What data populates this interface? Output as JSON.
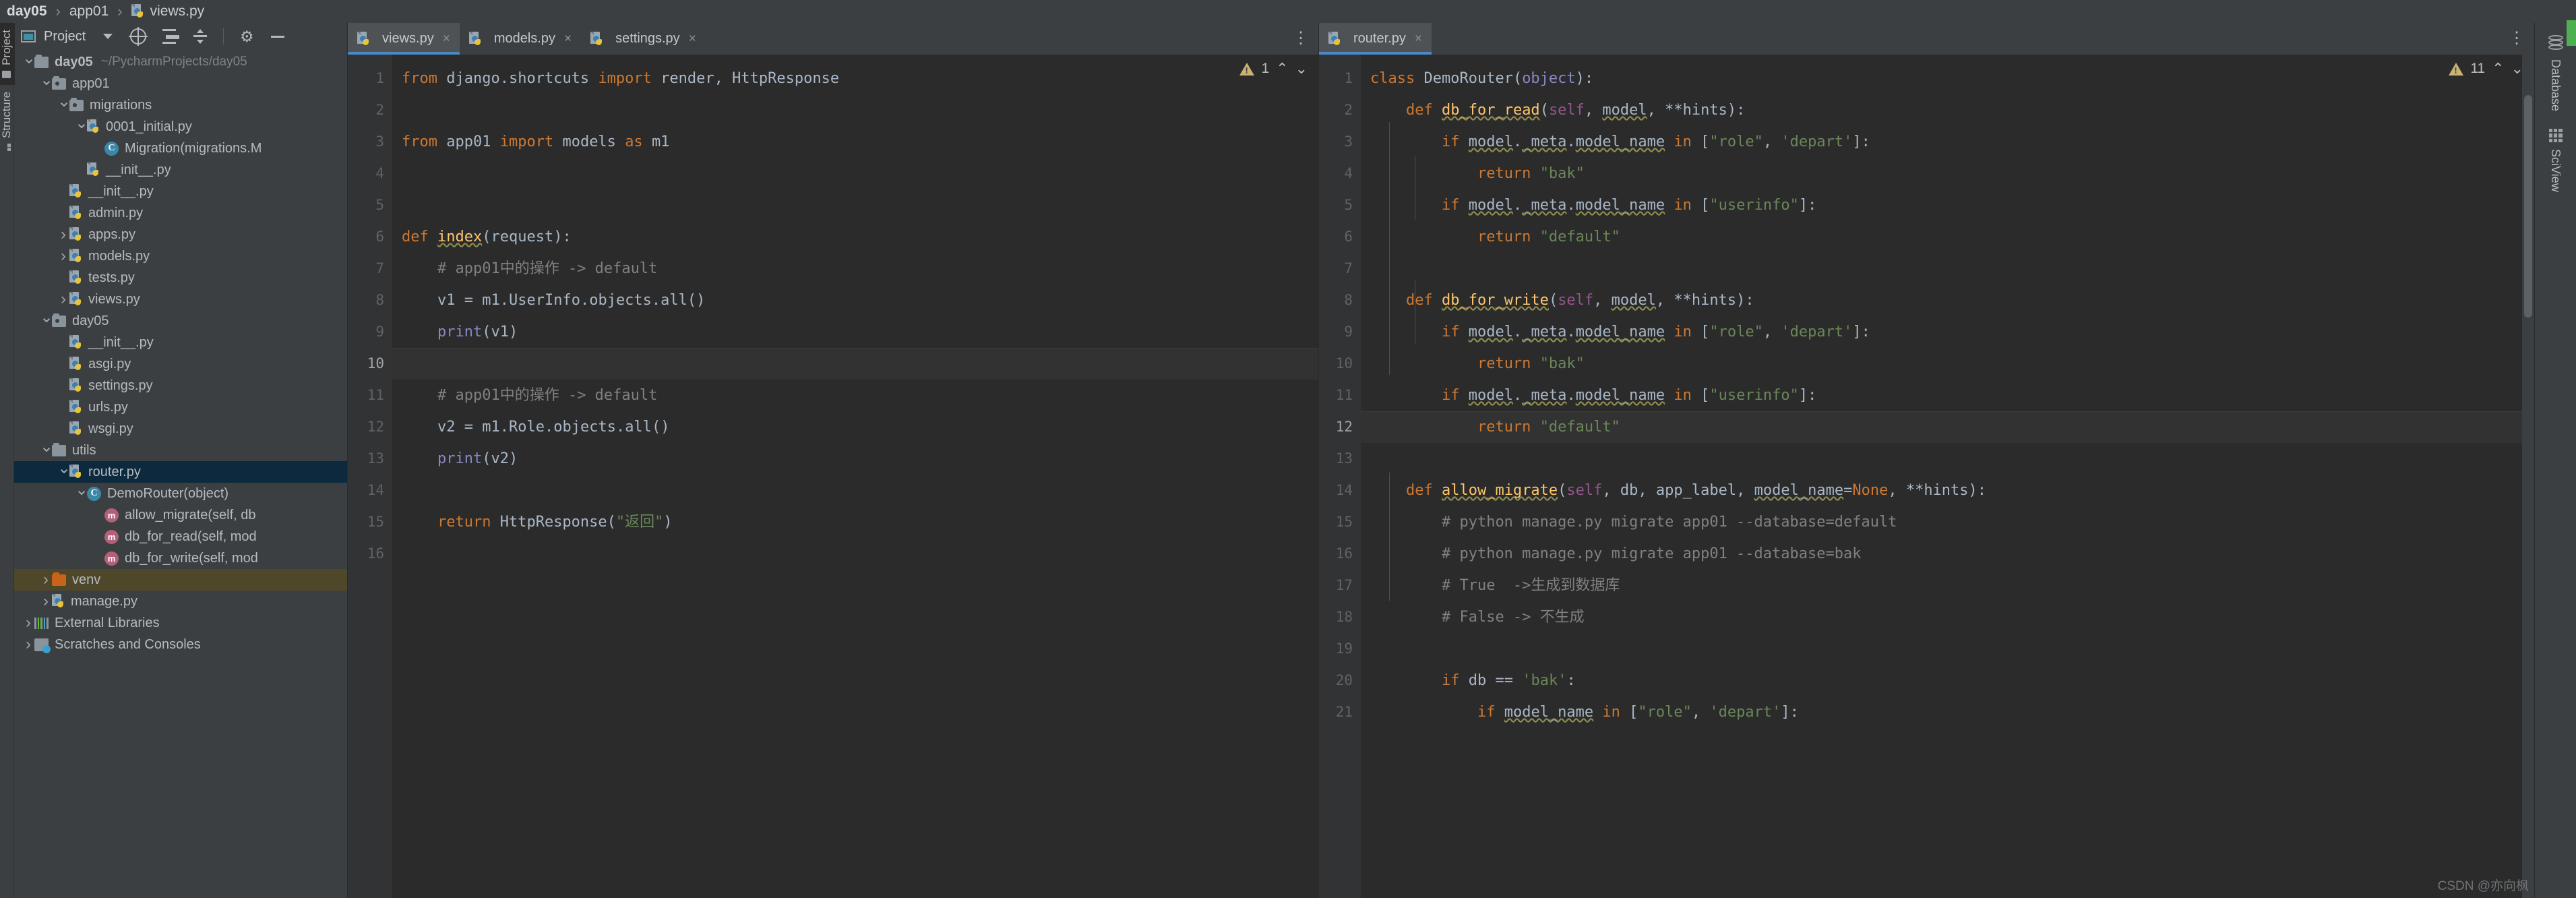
{
  "breadcrumb": {
    "items": [
      "day05",
      "app01",
      "views.py"
    ],
    "separator": "›",
    "file_icon": "python-file-icon"
  },
  "left_tool_strip": {
    "tabs": [
      {
        "label": "Project",
        "icon": "project-window-icon",
        "active": true
      },
      {
        "label": "Structure",
        "icon": "structure-icon",
        "active": false
      }
    ]
  },
  "project_panel": {
    "header": {
      "title": "Project",
      "dropdown_icon": "chevron-down-icon",
      "buttons": [
        {
          "name": "select-opened-file-icon",
          "label": "⊕"
        },
        {
          "name": "collapse-all-icon",
          "label": ""
        },
        {
          "name": "expand-all-icon",
          "label": ""
        },
        {
          "name": "settings-gear-icon",
          "label": "⚙"
        },
        {
          "name": "hide-panel-icon",
          "label": "—"
        }
      ]
    },
    "tree": [
      {
        "indent": 0,
        "arrow": "down",
        "icon": "folder",
        "label": "day05",
        "path": "~/PycharmProjects/day05",
        "bold": true
      },
      {
        "indent": 1,
        "arrow": "down",
        "icon": "folder-source",
        "label": "app01"
      },
      {
        "indent": 2,
        "arrow": "down",
        "icon": "folder-source",
        "label": "migrations"
      },
      {
        "indent": 3,
        "arrow": "down",
        "icon": "python-file",
        "label": "0001_initial.py"
      },
      {
        "indent": 4,
        "arrow": "none",
        "icon": "class",
        "label": "Migration(migrations.M"
      },
      {
        "indent": 3,
        "arrow": "none",
        "icon": "python-file",
        "label": "__init__.py"
      },
      {
        "indent": 2,
        "arrow": "none",
        "icon": "python-file",
        "label": "__init__.py"
      },
      {
        "indent": 2,
        "arrow": "none",
        "icon": "python-file",
        "label": "admin.py"
      },
      {
        "indent": 2,
        "arrow": "right",
        "icon": "python-file",
        "label": "apps.py"
      },
      {
        "indent": 2,
        "arrow": "right",
        "icon": "python-file",
        "label": "models.py"
      },
      {
        "indent": 2,
        "arrow": "none",
        "icon": "python-file",
        "label": "tests.py"
      },
      {
        "indent": 2,
        "arrow": "right",
        "icon": "python-file",
        "label": "views.py"
      },
      {
        "indent": 1,
        "arrow": "down",
        "icon": "folder-source",
        "label": "day05"
      },
      {
        "indent": 2,
        "arrow": "none",
        "icon": "python-file",
        "label": "__init__.py"
      },
      {
        "indent": 2,
        "arrow": "none",
        "icon": "python-file",
        "label": "asgi.py"
      },
      {
        "indent": 2,
        "arrow": "none",
        "icon": "python-file",
        "label": "settings.py"
      },
      {
        "indent": 2,
        "arrow": "none",
        "icon": "python-file",
        "label": "urls.py"
      },
      {
        "indent": 2,
        "arrow": "none",
        "icon": "python-file",
        "label": "wsgi.py"
      },
      {
        "indent": 1,
        "arrow": "down",
        "icon": "folder",
        "label": "utils"
      },
      {
        "indent": 2,
        "arrow": "down",
        "icon": "python-file",
        "label": "router.py",
        "selected": "blue"
      },
      {
        "indent": 3,
        "arrow": "down",
        "icon": "class",
        "label": "DemoRouter(object)"
      },
      {
        "indent": 4,
        "arrow": "none",
        "icon": "method",
        "label": "allow_migrate(self, db"
      },
      {
        "indent": 4,
        "arrow": "none",
        "icon": "method",
        "label": "db_for_read(self, mod"
      },
      {
        "indent": 4,
        "arrow": "none",
        "icon": "method",
        "label": "db_for_write(self, mod"
      },
      {
        "indent": 1,
        "arrow": "right",
        "icon": "folder-orange",
        "label": "venv",
        "selected": "yellow"
      },
      {
        "indent": 1,
        "arrow": "right",
        "icon": "python-file",
        "label": "manage.py"
      },
      {
        "indent": 0,
        "arrow": "right",
        "icon": "library",
        "label": "External Libraries"
      },
      {
        "indent": 0,
        "arrow": "right",
        "icon": "scratches",
        "label": "Scratches and Consoles"
      }
    ]
  },
  "left_editor": {
    "tabs": [
      {
        "label": "views.py",
        "active": true,
        "close": "×"
      },
      {
        "label": "models.py",
        "active": false,
        "close": "×"
      },
      {
        "label": "settings.py",
        "active": false,
        "close": "×"
      }
    ],
    "more_icon": "vertical-dots-icon",
    "current_line": 10,
    "line_count": 16,
    "lines": [
      {
        "n": 1,
        "text": "from django.shortcuts import render, HttpResponse"
      },
      {
        "n": 2,
        "text": ""
      },
      {
        "n": 3,
        "text": "from app01 import models as m1"
      },
      {
        "n": 4,
        "text": ""
      },
      {
        "n": 5,
        "text": ""
      },
      {
        "n": 6,
        "text": "def index(request):"
      },
      {
        "n": 7,
        "text": "    # app01中的操作 -> default"
      },
      {
        "n": 8,
        "text": "    v1 = m1.UserInfo.objects.all()"
      },
      {
        "n": 9,
        "text": "    print(v1)"
      },
      {
        "n": 10,
        "text": ""
      },
      {
        "n": 11,
        "text": "    # app01中的操作 -> default"
      },
      {
        "n": 12,
        "text": "    v2 = m1.Role.objects.all()"
      },
      {
        "n": 13,
        "text": "    print(v2)"
      },
      {
        "n": 14,
        "text": ""
      },
      {
        "n": 15,
        "text": "    return HttpResponse(\"返回\")"
      },
      {
        "n": 16,
        "text": ""
      }
    ],
    "inspection": {
      "warning_count": "1",
      "up_icon": "⌃",
      "down_icon": "⌄"
    }
  },
  "right_editor": {
    "tabs": [
      {
        "label": "router.py",
        "active": true,
        "close": "×"
      }
    ],
    "current_line": 12,
    "inspection": {
      "warning_count": "11",
      "up_icon": "⌃",
      "down_icon": "⌄"
    },
    "lines": [
      {
        "n": 1,
        "text": "class DemoRouter(object):"
      },
      {
        "n": 2,
        "text": "    def db_for_read(self, model, **hints):"
      },
      {
        "n": 3,
        "text": "        if model._meta.model_name in [\"role\", 'depart']:"
      },
      {
        "n": 4,
        "text": "            return \"bak\""
      },
      {
        "n": 5,
        "text": "        if model._meta.model_name in [\"userinfo\"]:"
      },
      {
        "n": 6,
        "text": "            return \"default\""
      },
      {
        "n": 7,
        "text": ""
      },
      {
        "n": 8,
        "text": "    def db_for_write(self, model, **hints):"
      },
      {
        "n": 9,
        "text": "        if model._meta.model_name in [\"role\", 'depart']:"
      },
      {
        "n": 10,
        "text": "            return \"bak\""
      },
      {
        "n": 11,
        "text": "        if model._meta.model_name in [\"userinfo\"]:"
      },
      {
        "n": 12,
        "text": "            return \"default\""
      },
      {
        "n": 13,
        "text": ""
      },
      {
        "n": 14,
        "text": "    def allow_migrate(self, db, app_label, model_name=None, **hints):"
      },
      {
        "n": 15,
        "text": "        # python manage.py migrate app01 --database=default"
      },
      {
        "n": 16,
        "text": "        # python manage.py migrate app01 --database=bak"
      },
      {
        "n": 17,
        "text": "        # True  ->生成到数据库"
      },
      {
        "n": 18,
        "text": "        # False -> 不生成"
      },
      {
        "n": 19,
        "text": ""
      },
      {
        "n": 20,
        "text": "        if db == 'bak':"
      },
      {
        "n": 21,
        "text": "            if model_name in [\"role\", 'depart']:"
      }
    ]
  },
  "right_tool_strip": {
    "tabs": [
      {
        "label": "Database",
        "icon": "database-icon"
      },
      {
        "label": "SciView",
        "icon": "sciview-grid-icon"
      }
    ]
  },
  "watermark": "CSDN @亦向枫",
  "colors": {
    "background": "#2b2b2b",
    "panel": "#3c3f41",
    "accent_blue": "#4a88c7",
    "selection_blue": "#0d293e",
    "selection_yellow": "#4e4729",
    "keyword": "#cc7832",
    "string": "#6a8759",
    "comment": "#808080",
    "function": "#ffc66d",
    "builtin": "#8888c6",
    "self": "#94558d",
    "number": "#6897bb",
    "text": "#a9b7c6"
  }
}
